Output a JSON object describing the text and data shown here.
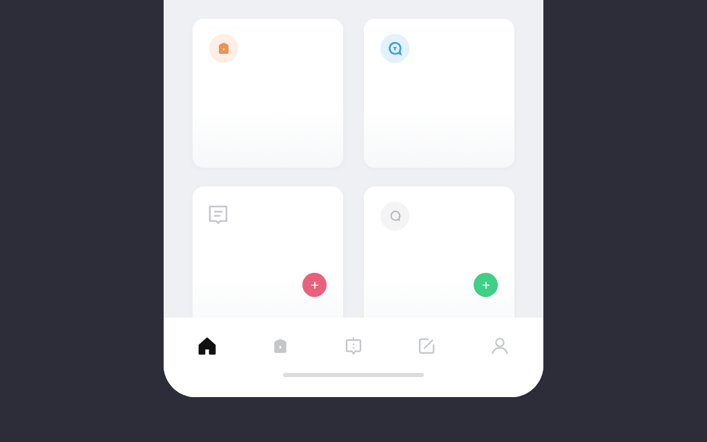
{
  "cards": [
    {
      "kind": "bag",
      "color": "#ef9158"
    },
    {
      "kind": "bubble",
      "color": "#3f9fdf"
    },
    {
      "kind": "note",
      "add_button": {
        "color": "#e9607a"
      }
    },
    {
      "kind": "chat",
      "color": "#b4b4ba",
      "add_button": {
        "color": "#3fcf86"
      }
    }
  ],
  "tab_bar": {
    "tabs": [
      {
        "kind": "home",
        "selected": true
      },
      {
        "kind": "bag",
        "selected": false
      },
      {
        "kind": "message",
        "selected": false
      },
      {
        "kind": "edit",
        "selected": false
      },
      {
        "kind": "profile",
        "selected": false
      }
    ]
  }
}
